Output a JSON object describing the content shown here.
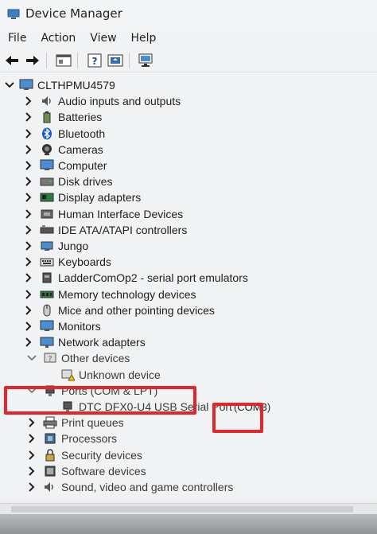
{
  "window": {
    "title": "Device Manager"
  },
  "menu": [
    "File",
    "Action",
    "View",
    "Help"
  ],
  "toolbar": {
    "buttons": [
      "back-arrow-icon",
      "forward-arrow-icon",
      "properties-icon",
      "help-icon",
      "update-driver-icon",
      "scan-monitor-icon"
    ]
  },
  "tree": {
    "root": "CLTHPMU4579",
    "items": [
      {
        "label": "Audio inputs and outputs",
        "icon": "speaker-icon",
        "state": "collapsed"
      },
      {
        "label": "Batteries",
        "icon": "battery-icon",
        "state": "collapsed"
      },
      {
        "label": "Bluetooth",
        "icon": "bluetooth-icon",
        "state": "collapsed"
      },
      {
        "label": "Cameras",
        "icon": "camera-icon",
        "state": "collapsed"
      },
      {
        "label": "Computer",
        "icon": "computer-icon",
        "state": "collapsed"
      },
      {
        "label": "Disk drives",
        "icon": "disk-icon",
        "state": "collapsed"
      },
      {
        "label": "Display adapters",
        "icon": "display-adapter-icon",
        "state": "collapsed"
      },
      {
        "label": "Human Interface Devices",
        "icon": "hid-icon",
        "state": "collapsed"
      },
      {
        "label": "IDE ATA/ATAPI controllers",
        "icon": "ide-controller-icon",
        "state": "collapsed"
      },
      {
        "label": "Jungo",
        "icon": "device-icon",
        "state": "collapsed"
      },
      {
        "label": "Keyboards",
        "icon": "keyboard-icon",
        "state": "collapsed"
      },
      {
        "label": "LadderComOp2 - serial port emulators",
        "icon": "serial-port-icon",
        "state": "collapsed"
      },
      {
        "label": "Memory technology devices",
        "icon": "memory-icon",
        "state": "collapsed"
      },
      {
        "label": "Mice and other pointing devices",
        "icon": "mouse-icon",
        "state": "collapsed"
      },
      {
        "label": "Monitors",
        "icon": "monitor-icon",
        "state": "collapsed"
      },
      {
        "label": "Network adapters",
        "icon": "network-icon",
        "state": "collapsed"
      },
      {
        "label": "Other devices",
        "icon": "unknown-device-icon",
        "state": "expanded"
      },
      {
        "label": "Unknown device",
        "icon": "warning-device-icon",
        "state": "child"
      },
      {
        "label": "Ports (COM & LPT)",
        "icon": "port-icon",
        "state": "expanded"
      },
      {
        "label": "DTC DFX0-U4 USB Serial Port",
        "suffix": "(COM3)",
        "icon": "port-icon",
        "state": "child"
      },
      {
        "label": "Print queues",
        "icon": "printer-icon",
        "state": "collapsed"
      },
      {
        "label": "Processors",
        "icon": "processor-icon",
        "state": "collapsed"
      },
      {
        "label": "Security devices",
        "icon": "security-icon",
        "state": "collapsed"
      },
      {
        "label": "Software devices",
        "icon": "software-device-icon",
        "state": "collapsed"
      },
      {
        "label": "Sound, video and game controllers",
        "icon": "sound-icon",
        "state": "collapsed"
      }
    ]
  },
  "colors": {
    "highlight": "#e3262b",
    "background": "#f1f2f3"
  }
}
